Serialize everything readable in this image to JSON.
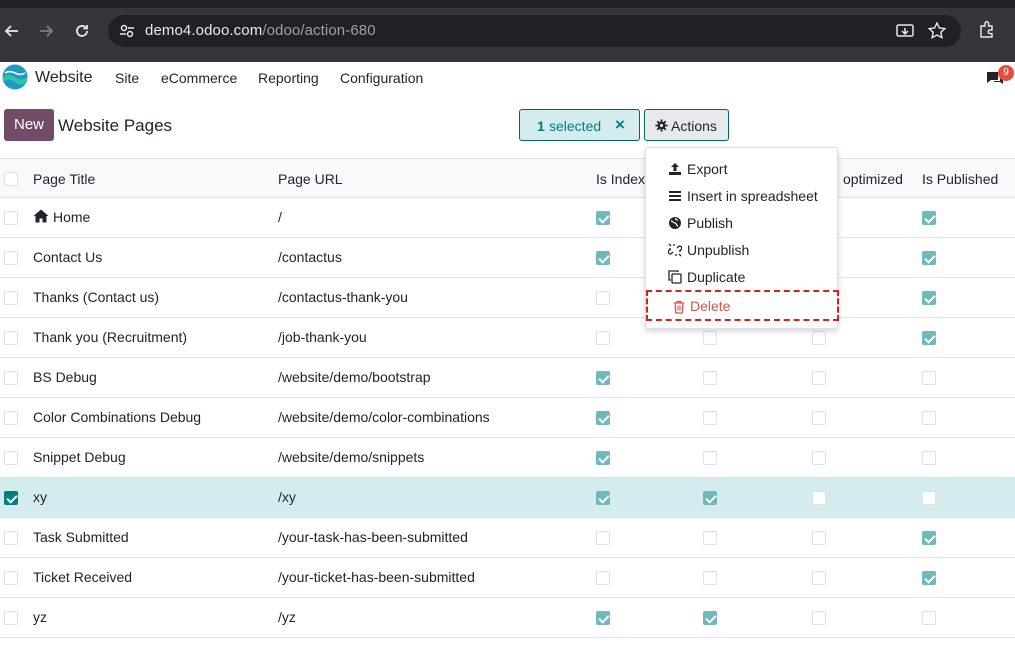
{
  "browser": {
    "url_host": "demo4.odoo.com",
    "url_path": "/odoo/action-680"
  },
  "navbar": {
    "app_name": "Website",
    "menu": [
      "Site",
      "eCommerce",
      "Reporting",
      "Configuration"
    ],
    "notification_count": "9"
  },
  "control_panel": {
    "new_label": "New",
    "title": "Website Pages",
    "selected_count": "1",
    "selected_word": "selected",
    "clear_label": "×",
    "actions_label": "Actions"
  },
  "table": {
    "headers": [
      "Page Title",
      "Page URL",
      "Is Index",
      "optimized",
      "Is Published"
    ],
    "rows": [
      {
        "title": "Home",
        "url": "/",
        "indexed": true,
        "c4": null,
        "c5": null,
        "published": true,
        "selected": false,
        "home": true
      },
      {
        "title": "Contact Us",
        "url": "/contactus",
        "indexed": true,
        "c4": null,
        "c5": null,
        "published": true,
        "selected": false
      },
      {
        "title": "Thanks (Contact us)",
        "url": "/contactus-thank-you",
        "indexed": false,
        "c4": null,
        "c5": null,
        "published": true,
        "selected": false
      },
      {
        "title": "Thank you (Recruitment)",
        "url": "/job-thank-you",
        "indexed": false,
        "c4": false,
        "c5": false,
        "published": true,
        "selected": false
      },
      {
        "title": "BS Debug",
        "url": "/website/demo/bootstrap",
        "indexed": true,
        "c4": false,
        "c5": false,
        "published": false,
        "selected": false
      },
      {
        "title": "Color Combinations Debug",
        "url": "/website/demo/color-combinations",
        "indexed": true,
        "c4": false,
        "c5": false,
        "published": false,
        "selected": false
      },
      {
        "title": "Snippet Debug",
        "url": "/website/demo/snippets",
        "indexed": true,
        "c4": false,
        "c5": false,
        "published": false,
        "selected": false
      },
      {
        "title": "xy",
        "url": "/xy",
        "indexed": true,
        "c4": true,
        "c5": false,
        "published": false,
        "selected": true
      },
      {
        "title": "Task Submitted",
        "url": "/your-task-has-been-submitted",
        "indexed": false,
        "c4": false,
        "c5": false,
        "published": true,
        "selected": false
      },
      {
        "title": "Ticket Received",
        "url": "/your-ticket-has-been-submitted",
        "indexed": false,
        "c4": false,
        "c5": false,
        "published": true,
        "selected": false
      },
      {
        "title": "yz",
        "url": "/yz",
        "indexed": true,
        "c4": true,
        "c5": false,
        "published": false,
        "selected": false
      }
    ]
  },
  "actions_menu": {
    "items": [
      {
        "label": "Export",
        "icon": "upload-icon"
      },
      {
        "label": "Insert in spreadsheet",
        "icon": "list-icon"
      },
      {
        "label": "Publish",
        "icon": "globe-icon"
      },
      {
        "label": "Unpublish",
        "icon": "unlink-icon"
      },
      {
        "label": "Duplicate",
        "icon": "copy-icon"
      },
      {
        "label": "Delete",
        "icon": "trash-icon"
      }
    ]
  },
  "colors": {
    "brand": "#714b67",
    "accent": "#017e84",
    "danger": "#d9534f"
  }
}
